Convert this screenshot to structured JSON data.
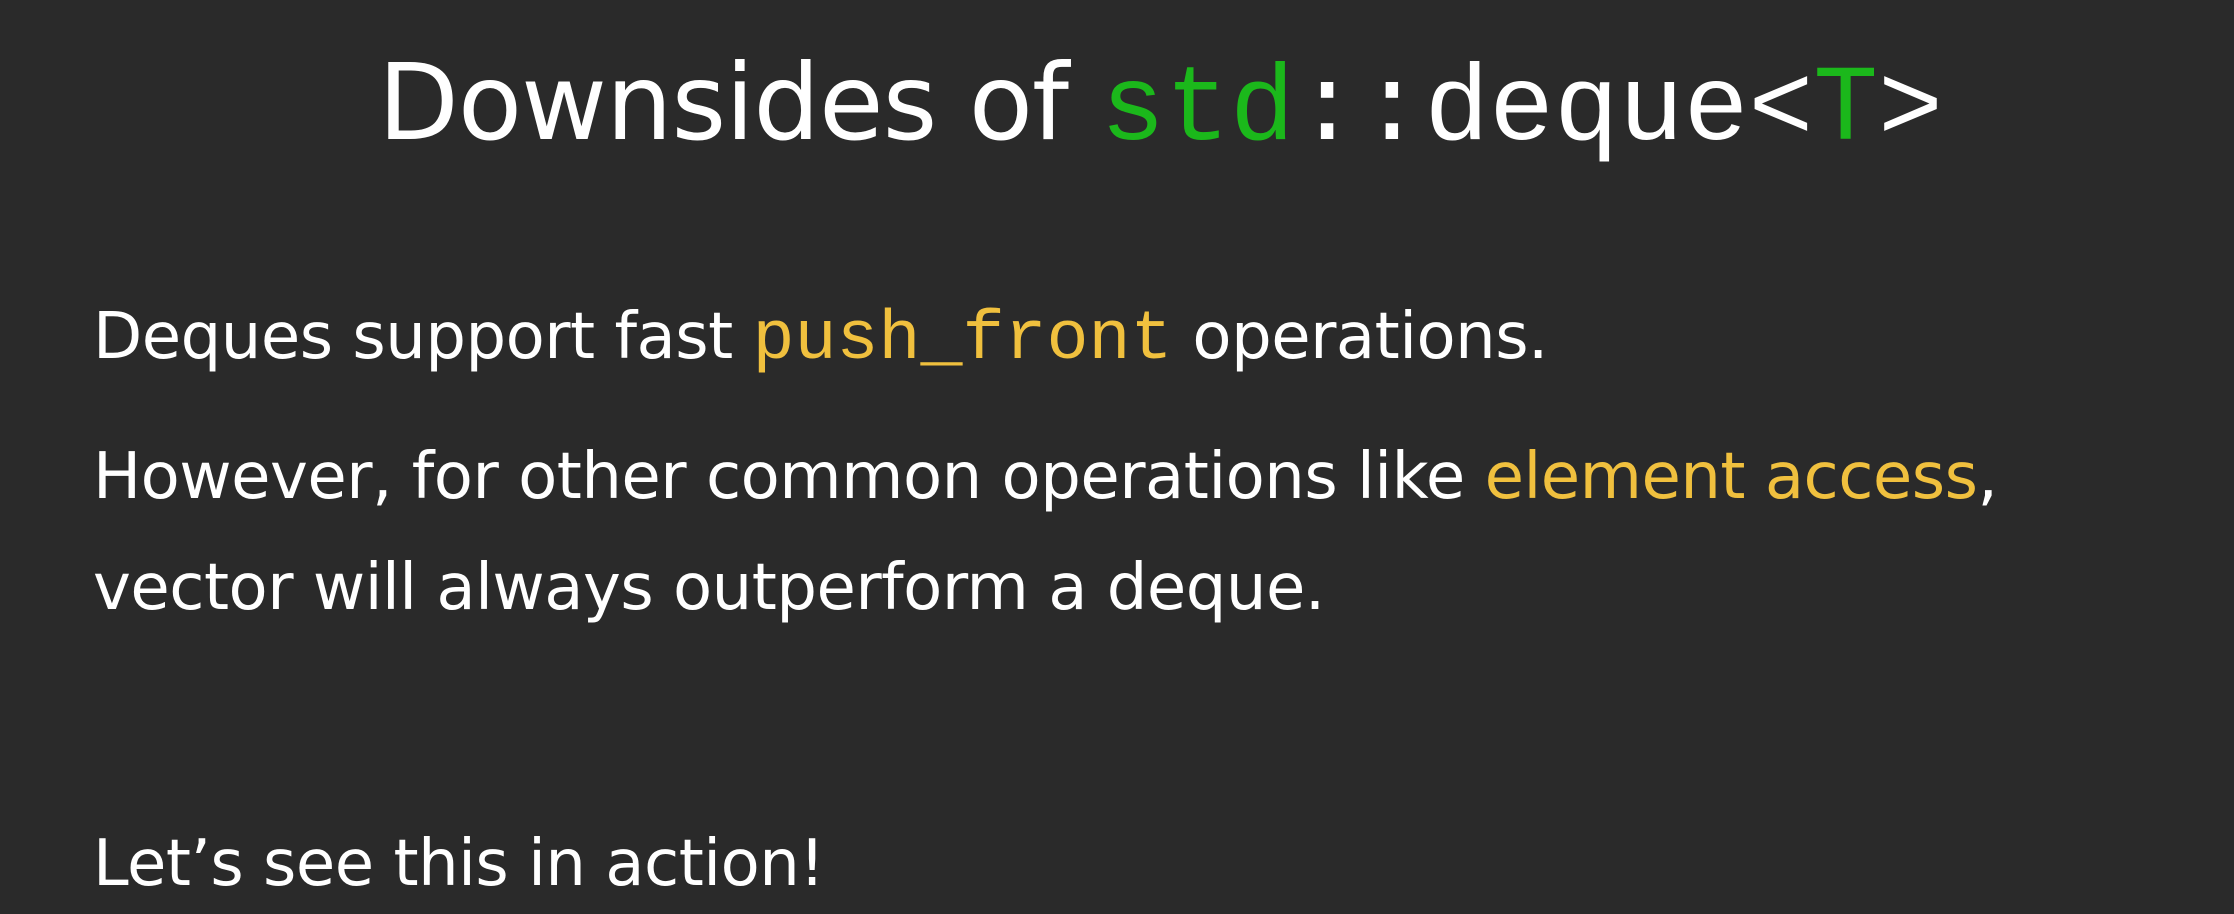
{
  "slide": {
    "title": {
      "prefix": "Downsides of ",
      "code_ns": "std",
      "code_sep": "::",
      "code_type": "deque",
      "code_lt": "<",
      "code_param": "T",
      "code_gt": ">"
    },
    "lines": [
      {
        "before": "Deques support fast ",
        "code": "push_front",
        "after": " operations."
      },
      {
        "before": "However, for other common operations like ",
        "highlight": "element access",
        "after": ","
      },
      {
        "text": "vector will always outperform a deque."
      },
      {
        "text": "Let’s see this in action!"
      }
    ]
  },
  "colors": {
    "background": "#2a2a2a",
    "text": "#ffffff",
    "code_green": "#1bb81b",
    "highlight_yellow": "#f0c03e"
  }
}
